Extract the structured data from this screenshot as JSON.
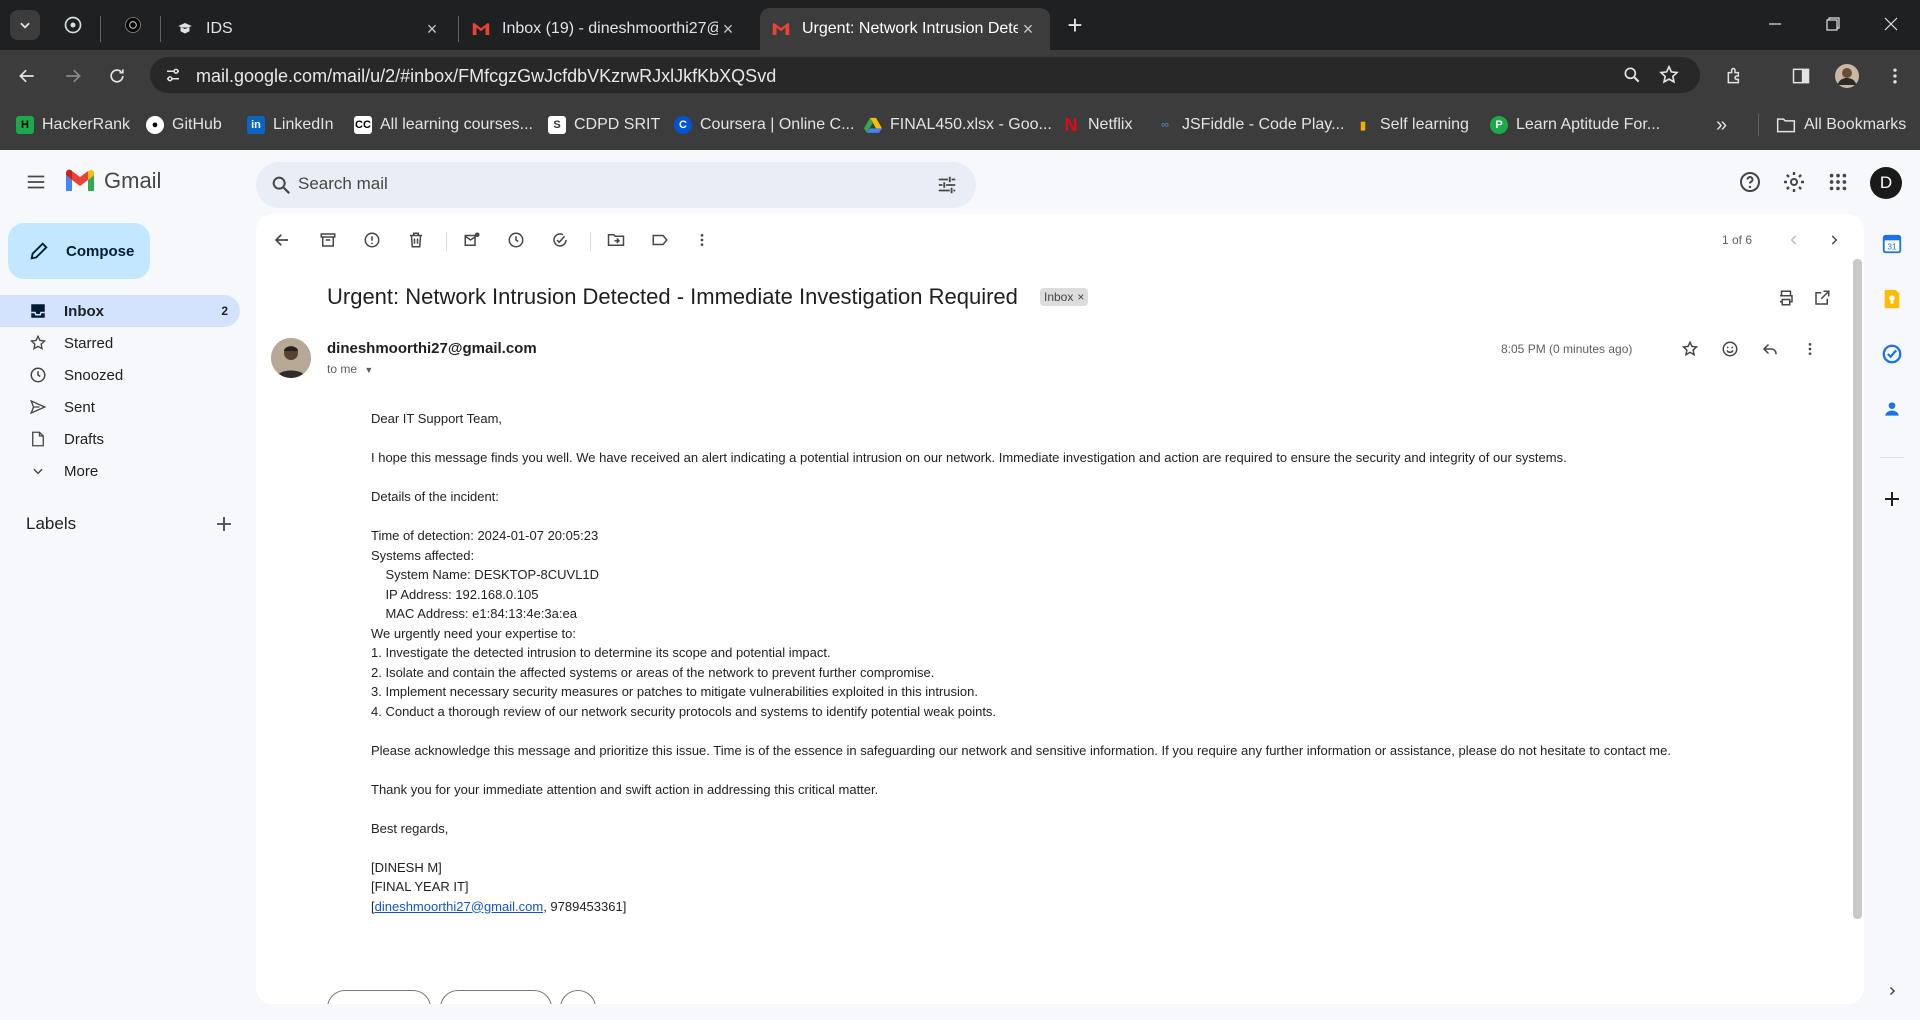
{
  "browser": {
    "tabs": [
      {
        "title": "IDS",
        "icon": "ids-favicon"
      },
      {
        "title": "Inbox (19) - dineshmoorthi27@",
        "icon": "gmail-favicon"
      },
      {
        "title": "Urgent: Network Intrusion Dete",
        "icon": "gmail-favicon"
      }
    ],
    "url": "mail.google.com/mail/u/2/#inbox/FMfcgzGwJcfdbVKzrwRJxlJkfKbXQSvd",
    "bookmarks": [
      "HackerRank",
      "GitHub",
      "LinkedIn",
      "All learning courses...",
      "CDPD SRIT",
      "Coursera | Online C...",
      "FINAL450.xlsx - Goo...",
      "Netflix",
      "JSFiddle - Code Play...",
      "Self learning",
      "Learn Aptitude For..."
    ],
    "all_bookmarks": "All Bookmarks"
  },
  "gmail": {
    "brand": "Gmail",
    "search_placeholder": "Search mail",
    "account_initial": "D",
    "compose": "Compose",
    "nav": [
      {
        "label": "Inbox",
        "count": "2"
      },
      {
        "label": "Starred"
      },
      {
        "label": "Snoozed"
      },
      {
        "label": "Sent"
      },
      {
        "label": "Drafts"
      },
      {
        "label": "More"
      }
    ],
    "labels_heading": "Labels",
    "pagination": "1 of 6"
  },
  "email": {
    "subject": "Urgent: Network Intrusion Detected - Immediate Investigation Required",
    "label_chip": "Inbox",
    "sender": "dineshmoorthi27@gmail.com",
    "to": "to me",
    "time": "8:05 PM (0 minutes ago)",
    "body": [
      "Dear IT Support Team,",
      "",
      "I hope this message finds you well. We have received an alert indicating a potential intrusion on our network. Immediate investigation and action are required to ensure the security and integrity of our systems.",
      "",
      "Details of the incident:",
      "",
      "Time of detection: 2024-01-07 20:05:23",
      "Systems affected:",
      "    System Name: DESKTOP-8CUVL1D",
      "    IP Address: 192.168.0.105",
      "    MAC Address: e1:84:13:4e:3a:ea",
      "We urgently need your expertise to:",
      "1. Investigate the detected intrusion to determine its scope and potential impact.",
      "2. Isolate and contain the affected systems or areas of the network to prevent further compromise.",
      "3. Implement necessary security measures or patches to mitigate vulnerabilities exploited in this intrusion.",
      "4. Conduct a thorough review of our network security protocols and systems to identify potential weak points.",
      "",
      "Please acknowledge this message and prioritize this issue. Time is of the essence in safeguarding our network and sensitive information. If you require any further information or assistance, please do not hesitate to contact me.",
      "",
      "Thank you for your immediate attention and swift action in addressing this critical matter.",
      "",
      "Best regards,",
      "",
      "[DINESH M]",
      "[FINAL YEAR IT]"
    ],
    "sig_open": "[",
    "sig_email": "dineshmoorthi27@gmail.com",
    "sig_rest": ", 9789453361]"
  }
}
